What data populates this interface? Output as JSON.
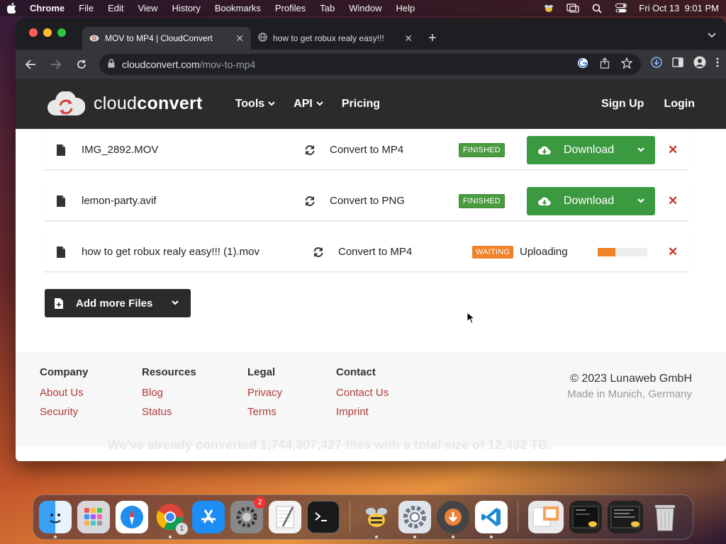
{
  "menubar": {
    "app_name": "Chrome",
    "items": [
      "File",
      "Edit",
      "View",
      "History",
      "Bookmarks",
      "Profiles",
      "Tab",
      "Window",
      "Help"
    ],
    "datetime": "Fri Oct 13  9:01 PM"
  },
  "browser": {
    "tabs": [
      {
        "title": "MOV to MP4 | CloudConvert",
        "active": true,
        "icon": "cloudconvert-favicon"
      },
      {
        "title": "how to get robux realy easy!!!",
        "active": false,
        "icon": "globe-icon"
      }
    ],
    "url_domain": "cloudconvert.com",
    "url_path": "/mov-to-mp4"
  },
  "site": {
    "logo_light": "cloud",
    "logo_bold": "convert",
    "nav": [
      "Tools",
      "API",
      "Pricing"
    ],
    "sign_up": "Sign Up",
    "login": "Login"
  },
  "files": [
    {
      "name": "IMG_2892.MOV",
      "action": "Convert to MP4",
      "status": "FINISHED",
      "button": "Download"
    },
    {
      "name": "lemon-party.avif",
      "action": "Convert to PNG",
      "status": "FINISHED",
      "button": "Download"
    },
    {
      "name": "how to get robux realy easy!!! (1).mov",
      "action": "Convert to MP4",
      "status": "WAITING",
      "progress_label": "Uploading",
      "progress_fraction": 0.35
    }
  ],
  "add_files_label": "Add more Files",
  "footer": {
    "columns": [
      {
        "heading": "Company",
        "links": [
          "About Us",
          "Security"
        ]
      },
      {
        "heading": "Resources",
        "links": [
          "Blog",
          "Status"
        ]
      },
      {
        "heading": "Legal",
        "links": [
          "Privacy",
          "Terms"
        ]
      },
      {
        "heading": "Contact",
        "links": [
          "Contact Us",
          "Imprint"
        ]
      }
    ],
    "copyright": "© 2023 Lunaweb GmbH",
    "made_in": "Made in Munich, Germany",
    "ghost_text": "We've already converted 1,744,307,427 files with a total size of 12,432 TB."
  },
  "dock": {
    "settings_badge": "2",
    "chrome_badge": "1"
  },
  "colors": {
    "finished": "#4a9b3f",
    "waiting": "#f08228",
    "download_green": "#3b9a3f",
    "link_red": "#b13a37"
  }
}
